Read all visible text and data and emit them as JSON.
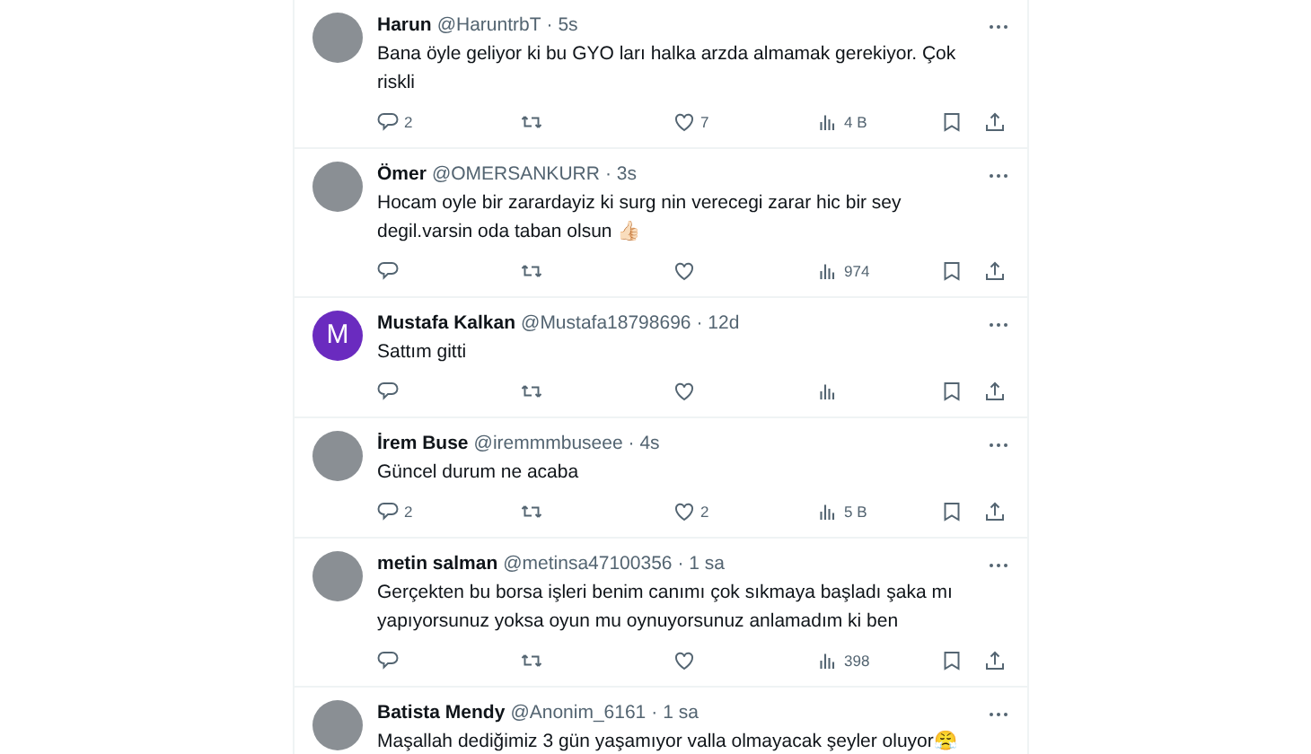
{
  "tweets": [
    {
      "name": "Harun",
      "handle": "@HaruntrbT",
      "time": "· 5s",
      "avatar": {
        "kind": "photo"
      },
      "text": "Bana öyle geliyor ki bu GYO ları halka arzda almamak gerekiyor. Çok riskli",
      "actions": [
        {
          "kind": "reply",
          "count": "2"
        },
        {
          "kind": "retweet"
        },
        {
          "kind": "like",
          "count": "7"
        },
        {
          "kind": "views",
          "count": "4 B"
        },
        {
          "kind": "bookmark"
        },
        {
          "kind": "share"
        }
      ]
    },
    {
      "name": "Ömer",
      "handle": "@OMERSANKURR",
      "time": "· 3s",
      "avatar": {
        "kind": "photo"
      },
      "text": "Hocam oyle bir zarardayiz ki surg nin verecegi zarar hic bir sey degil.varsin oda taban olsun 👍🏻",
      "actions": [
        {
          "kind": "reply"
        },
        {
          "kind": "retweet"
        },
        {
          "kind": "like"
        },
        {
          "kind": "views",
          "count": "974"
        },
        {
          "kind": "bookmark"
        },
        {
          "kind": "share"
        }
      ]
    },
    {
      "name": "Mustafa Kalkan",
      "handle": "@Mustafa18798696",
      "time": "· 12d",
      "avatar": {
        "kind": "letter",
        "letter": "M",
        "color": "#6a2bbf"
      },
      "text": "Sattım gitti",
      "actions": [
        {
          "kind": "reply"
        },
        {
          "kind": "retweet"
        },
        {
          "kind": "like"
        },
        {
          "kind": "views"
        },
        {
          "kind": "bookmark"
        },
        {
          "kind": "share"
        }
      ]
    },
    {
      "name": "İrem Buse",
      "handle": "@iremmmbuseee",
      "time": "· 4s",
      "avatar": {
        "kind": "photo"
      },
      "text": "Güncel durum ne acaba",
      "actions": [
        {
          "kind": "reply",
          "count": "2"
        },
        {
          "kind": "retweet"
        },
        {
          "kind": "like",
          "count": "2"
        },
        {
          "kind": "views",
          "count": "5 B"
        },
        {
          "kind": "bookmark"
        },
        {
          "kind": "share"
        }
      ]
    },
    {
      "name": "metin salman",
      "handle": "@metinsa47100356",
      "time": "· 1 sa",
      "avatar": {
        "kind": "photo"
      },
      "text": "Gerçekten bu borsa işleri benim canımı çok sıkmaya başladı şaka mı yapıyorsunuz yoksa oyun mu oynuyorsunuz anlamadım ki ben",
      "actions": [
        {
          "kind": "reply"
        },
        {
          "kind": "retweet"
        },
        {
          "kind": "like"
        },
        {
          "kind": "views",
          "count": "398"
        },
        {
          "kind": "bookmark"
        },
        {
          "kind": "share"
        }
      ]
    },
    {
      "name": "Batista Mendy",
      "handle": "@Anonim_6161",
      "time": "· 1 sa",
      "avatar": {
        "kind": "photo"
      },
      "text": "Maşallah dediğimiz 3 gün yaşamıyor valla olmayacak şeyler oluyor😤"
    }
  ]
}
